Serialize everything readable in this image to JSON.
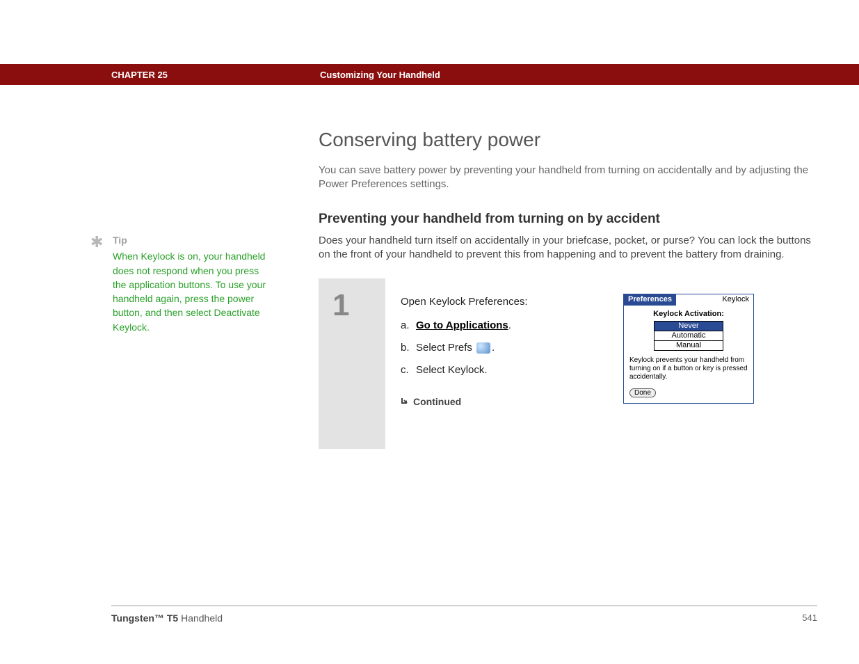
{
  "header": {
    "chapter": "CHAPTER 25",
    "title": "Customizing Your Handheld"
  },
  "tip": {
    "label": "Tip",
    "body": "When Keylock is on, your handheld does not respond when you press the application buttons. To use your handheld again, press the power button, and then select Deactivate Keylock."
  },
  "main": {
    "h1": "Conserving battery power",
    "intro": "You can save battery power by preventing your handheld from turning on accidentally and by adjusting the Power Preferences settings.",
    "h2": "Preventing your handheld from turning on by accident",
    "intro2": "Does your handheld turn itself on accidentally in your briefcase, pocket, or purse? You can lock the buttons on the front of your handheld to prevent this from happening and to prevent the battery from draining."
  },
  "step": {
    "number": "1",
    "lead": "Open Keylock Preferences:",
    "a_letter": "a.",
    "a_link": "Go to Applications",
    "a_after": ".",
    "b_letter": "b.",
    "b_before": "Select Prefs ",
    "b_after": ".",
    "c_letter": "c.",
    "c_text": "Select Keylock.",
    "continued": "Continued"
  },
  "palm": {
    "title_left": "Preferences",
    "title_right": "Keylock",
    "heading": "Keylock Activation:",
    "options": [
      "Never",
      "Automatic",
      "Manual"
    ],
    "selected": "Never",
    "desc": "Keylock prevents your handheld from turning on if a button or key is pressed accidentally.",
    "done": "Done"
  },
  "footer": {
    "product_bold": "Tungsten™ T5",
    "product_rest": " Handheld",
    "page": "541"
  }
}
